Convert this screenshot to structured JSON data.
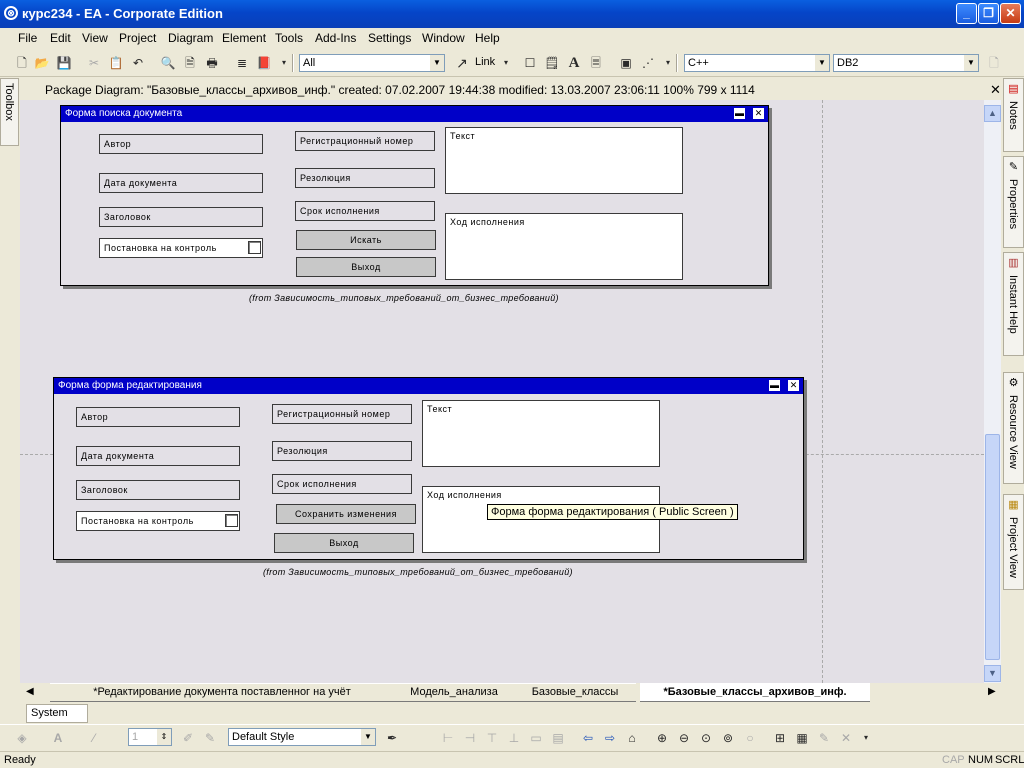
{
  "window": {
    "title": "курс234 - EA - Corporate Edition",
    "app_icon": "EA"
  },
  "menu": [
    "File",
    "Edit",
    "View",
    "Project",
    "Diagram",
    "Element",
    "Tools",
    "Add-Ins",
    "Settings",
    "Window",
    "Help"
  ],
  "toolbar": {
    "scope_combo": "All",
    "link_label": "Link",
    "language_combo": "C++",
    "database_combo": "DB2"
  },
  "diagram_info": {
    "text": "Package Diagram: \"Базовые_классы_архивов_инф.\"  created: 07.02.2007 19:44:38  modified: 13.03.2007 23:06:11   100%   799 x 1114"
  },
  "toolbox_tab": "Toolbox",
  "forms": [
    {
      "title": "Форма поиска документа",
      "fields_left": [
        "Автор",
        "Дата документа",
        "Заголовок",
        "Постановка на контроль"
      ],
      "fields_mid": [
        "Регистрационный номер",
        "Резолюция",
        "Срок исполнения"
      ],
      "buttons": [
        "Искать",
        "Выход"
      ],
      "areas": [
        "Текст",
        "Ход исполнения"
      ],
      "from_note": "(from Зависимость_типовых_требований_от_бизнес_требований)"
    },
    {
      "title": "Форма форма редактирования",
      "fields_left": [
        "Автор",
        "Дата документа",
        "Заголовок",
        "Постановка на контроль"
      ],
      "fields_mid": [
        "Регистрационный номер",
        "Резолюция",
        "Срок исполнения"
      ],
      "buttons": [
        "Сохранить изменения",
        "Выход"
      ],
      "areas": [
        "Текст",
        "Ход исполнения"
      ],
      "from_note": "(from Зависимость_типовых_требований_от_бизнес_требований)"
    }
  ],
  "tooltip": "Форма форма редактирования ( Public Screen )",
  "right_dock": [
    "Notes",
    "Properties",
    "Instant Help",
    "Resource View",
    "Project View"
  ],
  "diagram_tabs": [
    "*Редактирование документа поставленног на учёт",
    "Модель_анализа",
    "Базовые_классы",
    "*Базовые_классы_архивов_инф."
  ],
  "bottom_tab": "System",
  "bottom_toolbar": {
    "line_width": "1",
    "style_combo": "Default Style"
  },
  "status": {
    "left": "Ready",
    "cap": "CAP",
    "num": "NUM",
    "scrl": "SCRL"
  }
}
